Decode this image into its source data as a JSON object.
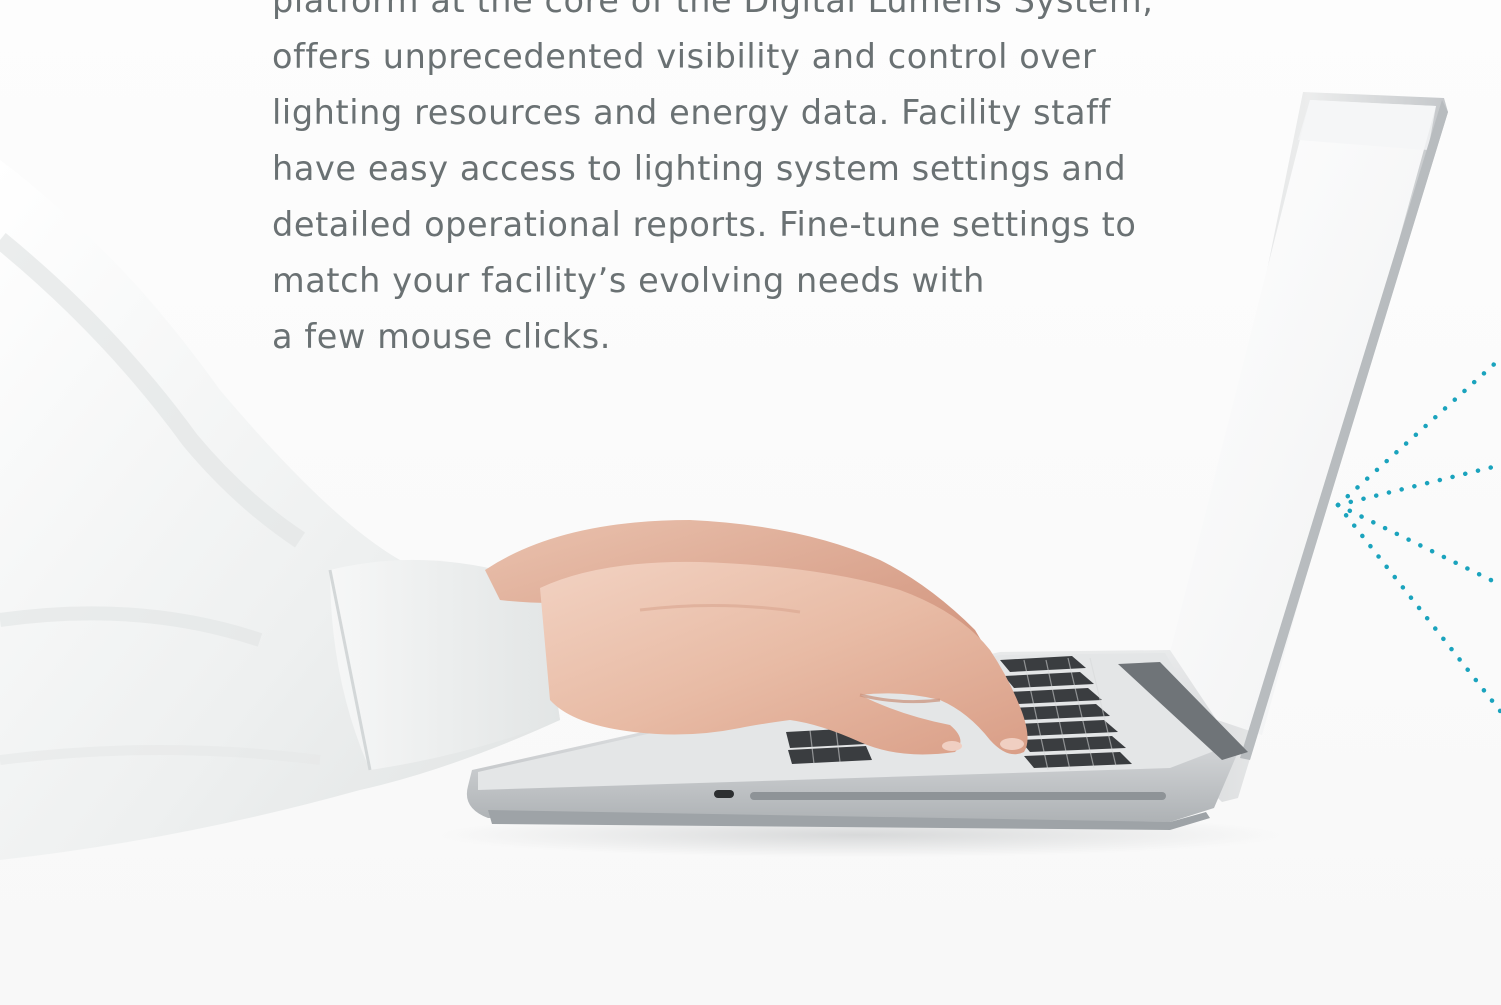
{
  "body_copy": {
    "lines": [
      "platform at the core of the Digital Lumens System,",
      "offers unprecedented visibility and control over",
      "lighting resources and energy data. Facility staff",
      "have easy access to lighting system settings and",
      "detailed operational reports. Fine-tune settings to",
      "match your facility’s evolving needs with",
      "a few mouse clicks."
    ]
  },
  "photo": {
    "subject": "hands-typing-on-laptop",
    "accent_color": "#1aa3bd"
  }
}
